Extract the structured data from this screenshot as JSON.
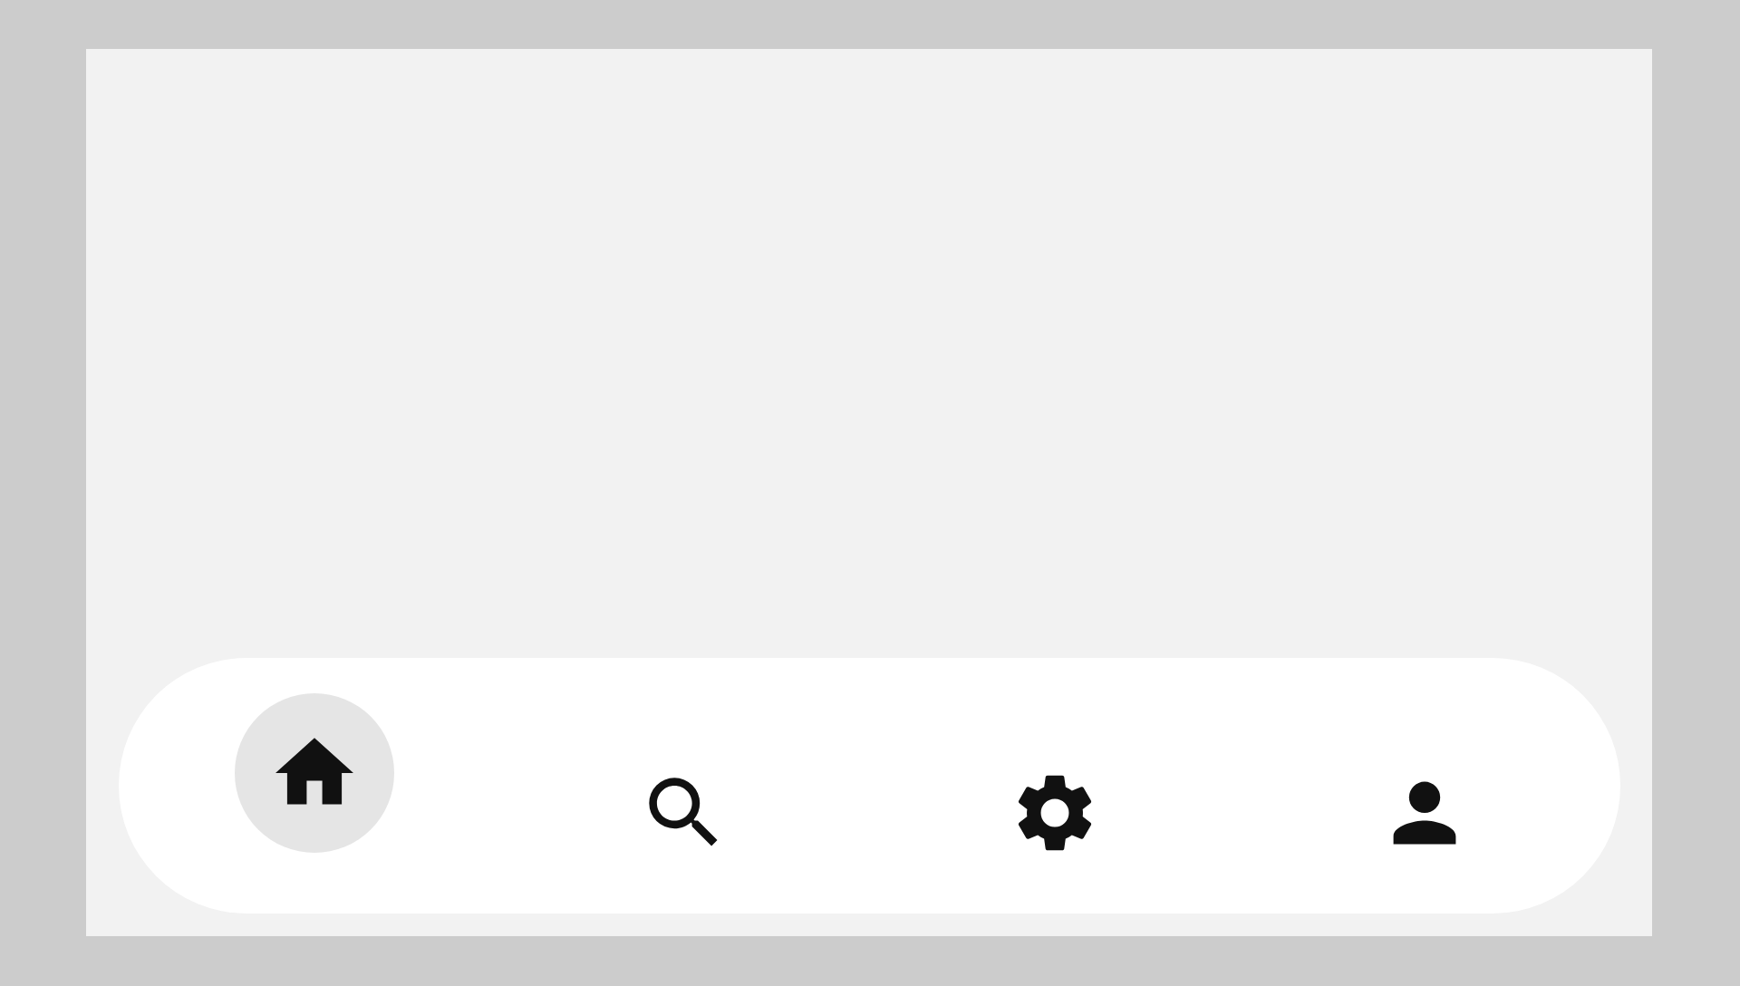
{
  "bottom_nav": {
    "items": [
      {
        "kind": "home",
        "selected": true
      },
      {
        "kind": "search",
        "selected": false
      },
      {
        "kind": "settings",
        "selected": false
      },
      {
        "kind": "profile",
        "selected": false
      }
    ]
  }
}
